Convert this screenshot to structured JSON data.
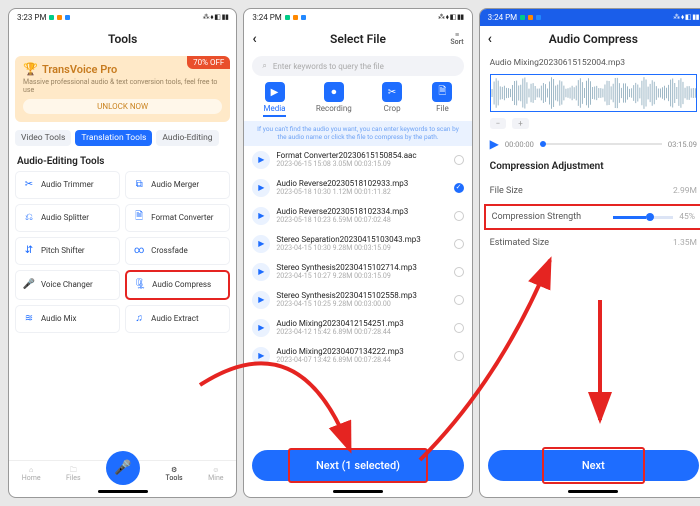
{
  "status": {
    "time": "3:23 PM",
    "time2": "3:24 PM",
    "time3": "3:24 PM",
    "icons_right": "⁂ ⬧ ◧ ▮▮"
  },
  "panel1": {
    "title": "Tools",
    "promo": {
      "name": "TransVoice Pro",
      "discount": "70% OFF",
      "sub": "Massive professional audio & text conversion tools, feel free to use",
      "unlock": "UNLOCK NOW"
    },
    "tabs": [
      "Video Tools",
      "Translation Tools",
      "Audio-Editing"
    ],
    "section": "Audio-Editing Tools",
    "tools": [
      {
        "icon": "✂",
        "label": "Audio Trimmer"
      },
      {
        "icon": "⧉",
        "label": "Audio Merger"
      },
      {
        "icon": "⎌",
        "label": "Audio Splitter"
      },
      {
        "icon": "🗎",
        "label": "Format Converter"
      },
      {
        "icon": "⇵",
        "label": "Pitch Shifter"
      },
      {
        "icon": "∞",
        "label": "Crossfade"
      },
      {
        "icon": "🎤",
        "label": "Voice Changer"
      },
      {
        "icon": "🗜",
        "label": "Audio Compress"
      },
      {
        "icon": "≋",
        "label": "Audio Mix"
      },
      {
        "icon": "♫",
        "label": "Audio Extract"
      }
    ],
    "nav": [
      "Home",
      "Files",
      "Tools",
      "Mine"
    ]
  },
  "panel2": {
    "title": "Select File",
    "sort": "Sort",
    "search_ph": "Enter keywords to query the file",
    "cats": [
      "Media",
      "Recording",
      "Crop",
      "File"
    ],
    "hint": "If you can't find the audio you want, you can enter keywords to scan by the audio name or click the file to compress by the path.",
    "files": [
      {
        "name": "Format Converter20230615150854.aac",
        "meta": "2023-06-15 15:08  3.05M  00:03:15.09"
      },
      {
        "name": "Audio Reverse20230518102933.mp3",
        "meta": "2023-05-18 10:30  1.12M  00:01:11.82",
        "checked": true
      },
      {
        "name": "Audio Reverse20230518102334.mp3",
        "meta": "2023-05-18 10:23  6.59M  00:07:02.48"
      },
      {
        "name": "Stereo Separation20230415103043.mp3",
        "meta": "2023-04-15 10:30  9.28M  00:03:15.09"
      },
      {
        "name": "Stereo Synthesis20230415102714.mp3",
        "meta": "2023-04-15 10:27  9.28M  00:03:15.09"
      },
      {
        "name": "Stereo Synthesis20230415102558.mp3",
        "meta": "2023-04-15 10:25  9.28M  00:03:00.00"
      },
      {
        "name": "Audio Mixing20230412154251.mp3",
        "meta": "2023-04-12 15:42  6.89M  00:07:28.44"
      },
      {
        "name": "Audio Mixing20230407134222.mp3",
        "meta": "2023-04-07 13:42  6.89M  00:07:28.44"
      }
    ],
    "next": "Next (1 selected)"
  },
  "panel3": {
    "title": "Audio Compress",
    "filename": "Audio Mixing20230615152004.mp3",
    "zoom_minus": "−",
    "zoom_plus": "+",
    "t0": "00:00:00",
    "t1": "03:15.09",
    "adj_hdr": "Compression Adjustment",
    "rows": {
      "fs_label": "File Size",
      "fs_val": "2.99M",
      "cs_label": "Compression Strength",
      "cs_val": "45%",
      "es_label": "Estimated Size",
      "es_val": "1.35M"
    },
    "next": "Next"
  }
}
